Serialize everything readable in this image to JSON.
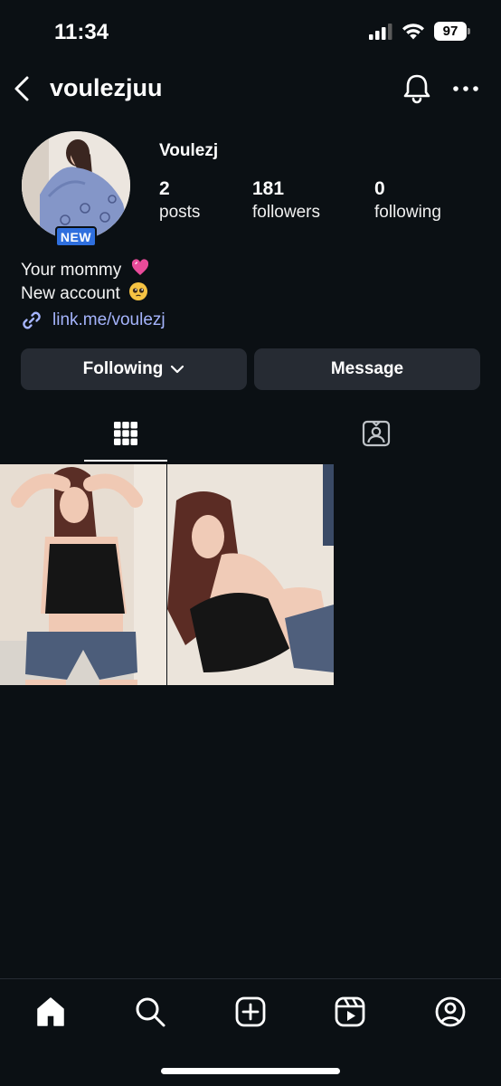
{
  "status_bar": {
    "time": "11:34",
    "battery": "97",
    "icons": [
      "cellular-signal-icon",
      "wifi-icon",
      "battery-icon"
    ]
  },
  "header": {
    "username": "voulezjuu",
    "icons": [
      "back-chevron-icon",
      "bell-icon",
      "more-dots-icon"
    ]
  },
  "profile": {
    "display_name": "Voulezj",
    "badge": "NEW",
    "stats": [
      {
        "value": "2",
        "label": "posts"
      },
      {
        "value": "181",
        "label": "followers"
      },
      {
        "value": "0",
        "label": "following"
      }
    ],
    "bio": [
      "Your mommy",
      "New account"
    ],
    "link": "link.me/voulezj"
  },
  "actions": {
    "following_label": "Following",
    "message_label": "Message"
  },
  "tabs": [
    {
      "icon": "grid-icon",
      "active": true
    },
    {
      "icon": "tagged-icon",
      "active": false
    }
  ],
  "posts_count_shown": 2,
  "bottom_nav": [
    "home-icon",
    "search-icon",
    "create-icon",
    "reels-icon",
    "profile-icon"
  ],
  "colors": {
    "background": "#0b1014",
    "button": "#262b33",
    "link": "#a5b4fc",
    "badge": "#2f6fde"
  }
}
